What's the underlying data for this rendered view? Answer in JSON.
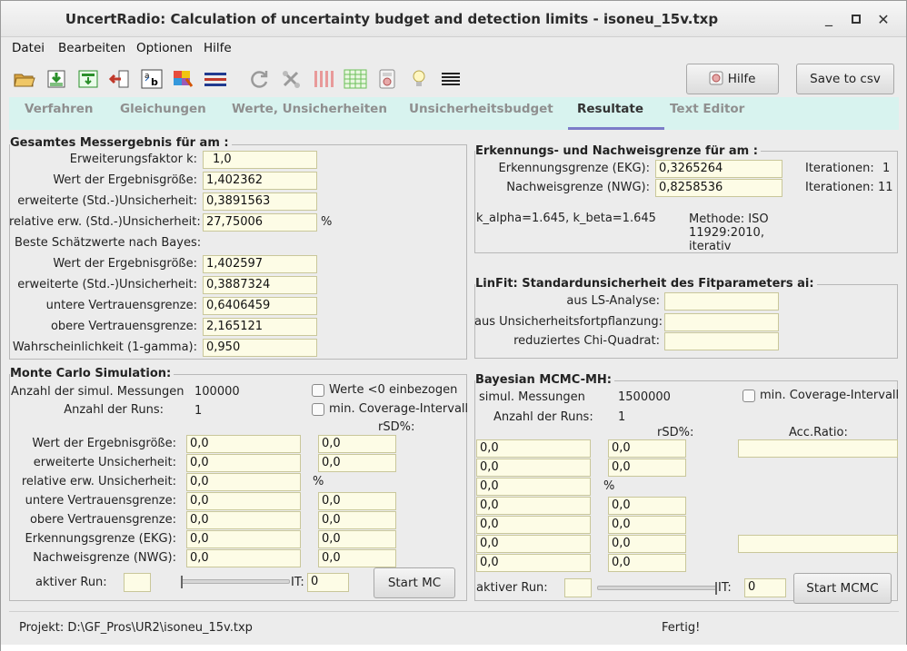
{
  "window": {
    "title": "UncertRadio: Calculation of uncertainty budget and detection limits   -   isoneu_15v.txp",
    "minimize": "_",
    "maximize": "▫",
    "close": "✕"
  },
  "menu": [
    "Datei",
    "Bearbeiten",
    "Optionen",
    "Hilfe"
  ],
  "toolbar": {
    "icons": [
      "open-file-icon",
      "save-file-icon",
      "save-as-icon",
      "close-project-icon",
      "font-icon",
      "color-icon",
      "inactive-table-icon",
      "refresh-icon",
      "settings-icon",
      "tubes-icon",
      "grid-icon",
      "calculator-icon",
      "tip-icon",
      "list-icon"
    ],
    "help_label": "Hilfe",
    "save_csv_label": "Save to csv"
  },
  "tabs": [
    "Verfahren",
    "Gleichungen",
    "Werte, Unsicherheiten",
    "Unsicherheitsbudget",
    "Resultate",
    "Text Editor"
  ],
  "active_tab": "Resultate",
  "result": {
    "title": "Gesamtes Messergebnis für am :",
    "k_label": "Erweiterungsfaktor k:",
    "k_value": "1,0",
    "value_label": "Wert der Ergebnisgröße:",
    "value": "1,402362",
    "unc_label": "erweiterte (Std.-)Unsicherheit:",
    "unc_value": "0,3891563",
    "rel_label": "relative erw. (Std.-)Unsicherheit:",
    "rel_value": "27,75006",
    "rel_unit": "%",
    "bayes_heading": "Beste Schätzwerte nach Bayes:",
    "b_value_label": "Wert der Ergebnisgröße:",
    "b_value": "1,402597",
    "b_unc_label": "erweiterte (Std.-)Unsicherheit:",
    "b_unc_value": "0,3887324",
    "lower_label": "untere Vertrauensgrenze:",
    "lower_value": "0,6406459",
    "upper_label": "obere Vertrauensgrenze:",
    "upper_value": "2,165121",
    "prob_label": "Wahrscheinlichkeit (1-gamma):",
    "prob_value": "0,950"
  },
  "limits": {
    "title": "Erkennungs- und Nachweisgrenze für am :",
    "ekg_label": "Erkennungsgrenze (EKG):",
    "ekg_value": "0,3265264",
    "nwg_label": "Nachweisgrenze (NWG):",
    "nwg_value": "0,8258536",
    "iter_label_1": "Iterationen:",
    "iter_value_1": "1",
    "iter_label_2": "Iterationen:",
    "iter_value_2": "11",
    "kalpha_text": "k_alpha=1.645,  k_beta=1.645",
    "method_line1": "Methode: ISO",
    "method_line2": "11929:2010,",
    "method_line3": "iterativ"
  },
  "linfit": {
    "title": "LinFit: Standardunsicherheit des Fitparameters ai:",
    "ls_label": "aus LS-Analyse:",
    "ls_value": "",
    "prop_label": "aus Unsicherheitsfortpflanzung:",
    "prop_value": "",
    "chi_label": "reduziertes Chi-Quadrat:",
    "chi_value": ""
  },
  "mc": {
    "title": "Monte Carlo Simulation:",
    "n_label": "Anzahl der simul. Messungen",
    "n_value": "100000",
    "runs_label": "Anzahl der Runs:",
    "runs_value": "1",
    "neg_label": "Werte <0 einbezogen",
    "neg_checked": false,
    "cov_label": "min. Coverage-Intervall",
    "cov_checked": false,
    "rsd_header": "rSD%:",
    "rows": [
      {
        "label": "Wert der Ergebnisgröße:",
        "value": "0,0",
        "rsd": "0,0"
      },
      {
        "label": "erweiterte Unsicherheit:",
        "value": "0,0",
        "rsd": "0,0"
      },
      {
        "label": "relative erw. Unsicherheit:",
        "value": "0,0",
        "rsd": "%"
      },
      {
        "label": "untere Vertrauensgrenze:",
        "value": "0,0",
        "rsd": "0,0"
      },
      {
        "label": "obere Vertrauensgrenze:",
        "value": "0,0",
        "rsd": "0,0"
      },
      {
        "label": "Erkennungsgrenze (EKG):",
        "value": "0,0",
        "rsd": "0,0"
      },
      {
        "label": "Nachweisgrenze (NWG):",
        "value": "0,0",
        "rsd": "0,0"
      }
    ],
    "active_run_label": "aktiver Run:",
    "active_run_value": "",
    "slider_position": 0.0,
    "it_label": "IT:",
    "it_value": "0",
    "start_label": "Start MC"
  },
  "mcmc": {
    "title": "Bayesian MCMC-MH:",
    "n_label": "simul. Messungen",
    "n_value": "1500000",
    "runs_label": "Anzahl der Runs:",
    "runs_value": "1",
    "cov_label": "min. Coverage-Intervall",
    "cov_checked": false,
    "rsd_header": "rSD%:",
    "acc_header": "Acc.Ratio:",
    "rows": [
      {
        "value": "0,0",
        "rsd": "0,0"
      },
      {
        "value": "0,0",
        "rsd": "0,0"
      },
      {
        "value": "0,0",
        "rsd": "%"
      },
      {
        "value": "0,0",
        "rsd": "0,0"
      },
      {
        "value": "0,0",
        "rsd": "0,0"
      },
      {
        "value": "0,0",
        "rsd": "0,0"
      },
      {
        "value": "0,0",
        "rsd": "0,0"
      }
    ],
    "acc_value_1": "",
    "acc_value_2": "",
    "active_run_label": "aktiver Run:",
    "active_run_value": "",
    "slider_position": 1.0,
    "it_label": "IT:",
    "it_value": "0",
    "start_label": "Start MCMC"
  },
  "status": {
    "project": "Projekt: D:\\GF_Pros\\UR2\\isoneu_15v.txp",
    "state": "Fertig!"
  }
}
